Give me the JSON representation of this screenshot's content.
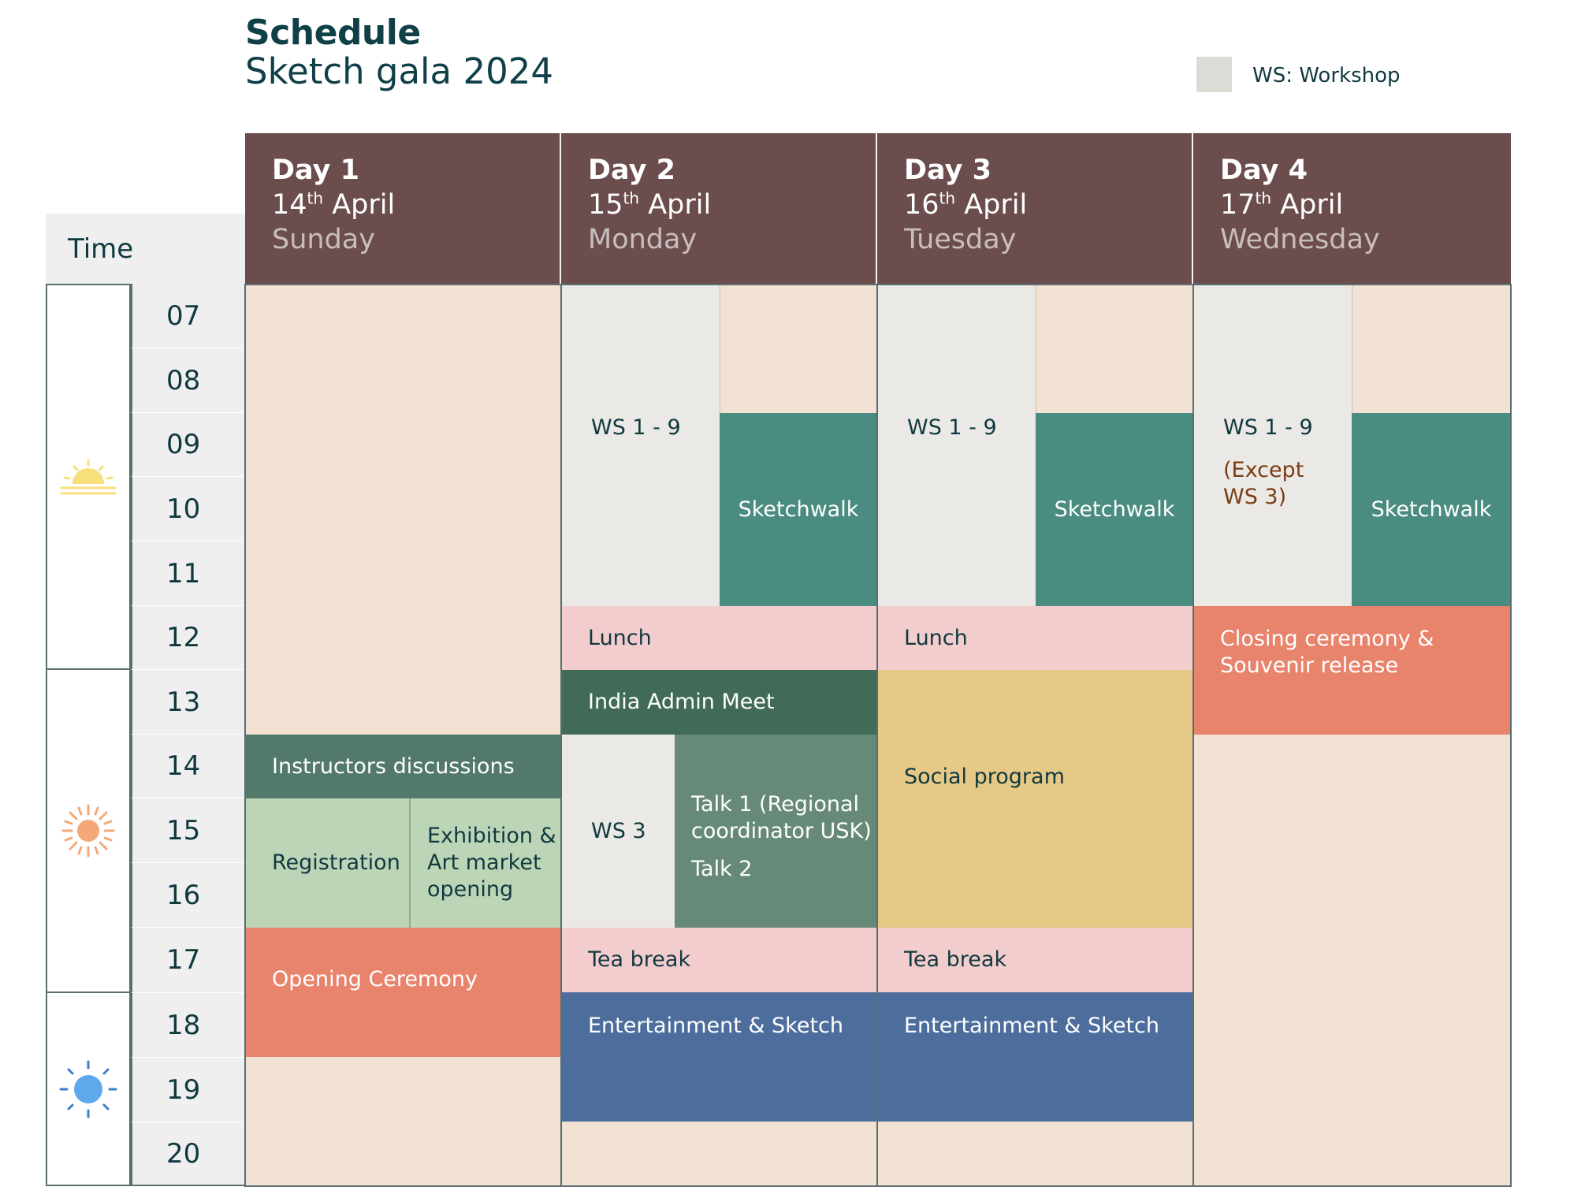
{
  "header": {
    "title": "Schedule",
    "subtitle": "Sketch gala 2024"
  },
  "legend": {
    "label": "WS: Workshop",
    "color": "#dcdcd6"
  },
  "time_label": "Time",
  "days": [
    {
      "name": "Day 1",
      "date_num": "14",
      "date_suffix": "th",
      "month": "April",
      "weekday": "Sunday"
    },
    {
      "name": "Day 2",
      "date_num": "15",
      "date_suffix": "th",
      "month": "April",
      "weekday": "Monday"
    },
    {
      "name": "Day 3",
      "date_num": "16",
      "date_suffix": "th",
      "month": "April",
      "weekday": "Tuesday"
    },
    {
      "name": "Day 4",
      "date_num": "17",
      "date_suffix": "th",
      "month": "April",
      "weekday": "Wednesday"
    }
  ],
  "hours": [
    "07",
    "08",
    "09",
    "10",
    "11",
    "12",
    "13",
    "14",
    "15",
    "16",
    "17",
    "18",
    "19",
    "20"
  ],
  "periods": [
    {
      "icon": "sunrise-icon"
    },
    {
      "icon": "sun-icon"
    },
    {
      "icon": "night-sun-icon"
    }
  ],
  "events": {
    "d1_instructors": "Instructors discussions",
    "d1_registration": "Registration",
    "d1_exhibition": "Exhibition & Art market opening",
    "d1_opening": "Opening Ceremony",
    "d2_ws": "WS 1 - 9",
    "d2_sketchwalk": "Sketchwalk",
    "d2_lunch": "Lunch",
    "d2_india": "India Admin Meet",
    "d2_ws3": "WS 3",
    "d2_talk1": "Talk 1 (Regional coordinator USK)",
    "d2_talk2": "Talk 2",
    "d2_tea": "Tea break",
    "d2_ent": "Entertainment & Sketch",
    "d3_ws": "WS 1 - 9",
    "d3_sketchwalk": "Sketchwalk",
    "d3_lunch": "Lunch",
    "d3_social": "Social program",
    "d3_tea": "Tea break",
    "d3_ent": "Entertainment & Sketch",
    "d4_ws": "WS 1 - 9",
    "d4_except": "(Except WS 3)",
    "d4_sketchwalk": "Sketchwalk",
    "d4_closing": "Closing ceremony & Souvenir release"
  }
}
